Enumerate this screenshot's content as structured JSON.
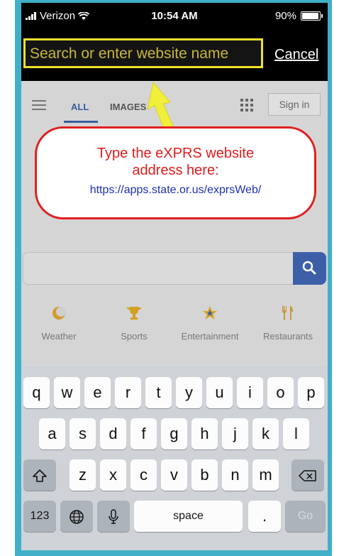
{
  "status_bar": {
    "carrier": "Verizon",
    "time": "10:54 AM",
    "battery": "90%"
  },
  "browser": {
    "search_placeholder": "Search or enter website name",
    "cancel_label": "Cancel"
  },
  "google": {
    "tab_all": "ALL",
    "tab_images": "IMAGES",
    "sign_in": "Sign in",
    "shortcuts": [
      {
        "label": "Weather",
        "icon": "weather-icon"
      },
      {
        "label": "Sports",
        "icon": "trophy-icon"
      },
      {
        "label": "Entertainment",
        "icon": "star-icon"
      },
      {
        "label": "Restaurants",
        "icon": "fork-knife-icon"
      }
    ]
  },
  "callout": {
    "line1": "Type the eXPRS website",
    "line2": "address here:",
    "url": "https://apps.state.or.us/exprsWeb/"
  },
  "keyboard": {
    "row1": [
      "q",
      "w",
      "e",
      "r",
      "t",
      "y",
      "u",
      "i",
      "o",
      "p"
    ],
    "row2": [
      "a",
      "s",
      "d",
      "f",
      "g",
      "h",
      "j",
      "k",
      "l"
    ],
    "row3": [
      "z",
      "x",
      "c",
      "v",
      "b",
      "n",
      "m"
    ],
    "numbers_label": "123",
    "space_label": "space",
    "period_label": ".",
    "go_label": "Go"
  },
  "colors": {
    "highlight": "#f0e12a",
    "callout_border": "#e02020",
    "callout_url": "#1e2fb0",
    "frame": "#3fb0c8"
  }
}
